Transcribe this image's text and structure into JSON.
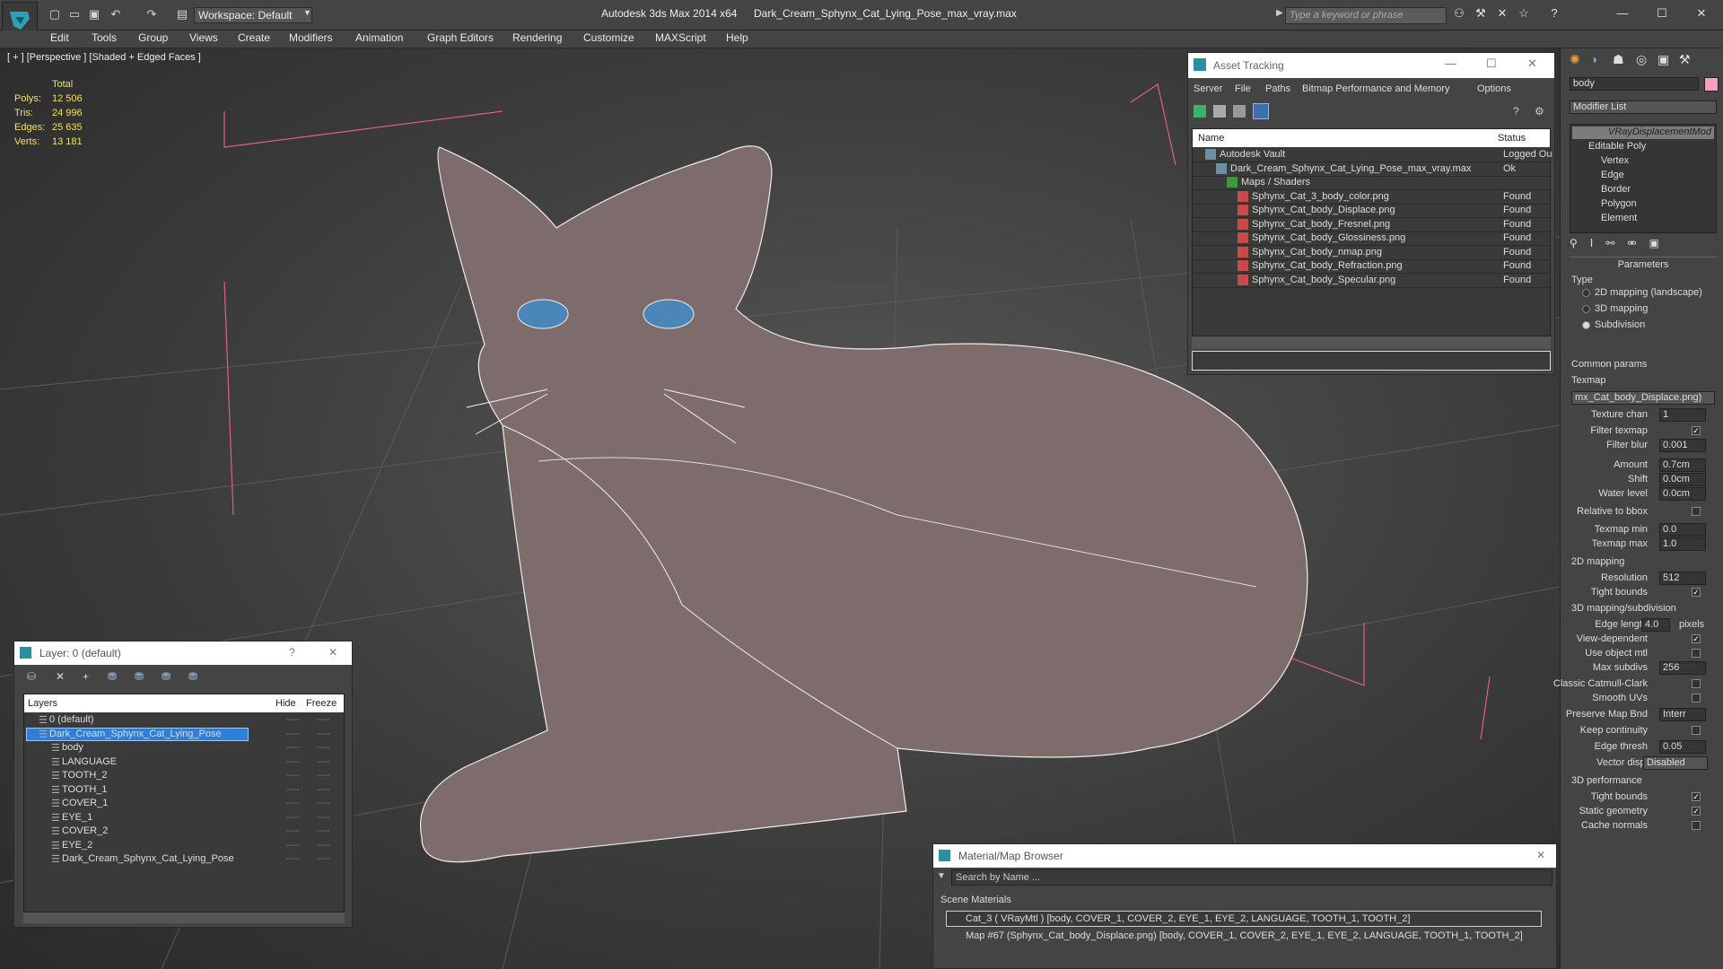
{
  "window": {
    "title": "Autodesk 3ds Max  2014 x64",
    "filename": "Dark_Cream_Sphynx_Cat_Lying_Pose_max_vray.max",
    "workspace": "Workspace: Default",
    "search_placeholder": "Type a keyword or phrase"
  },
  "menu": [
    "Edit",
    "Tools",
    "Group",
    "Views",
    "Create",
    "Modifiers",
    "Animation",
    "Graph Editors",
    "Rendering",
    "Customize",
    "MAXScript",
    "Help"
  ],
  "viewport": {
    "label": "[ + ] [Perspective ] [Shaded + Edged Faces ]",
    "stats": {
      "header": "Total",
      "rows": [
        {
          "k": "Polys:",
          "v": "12 506"
        },
        {
          "k": "Tris:",
          "v": "24 996"
        },
        {
          "k": "Edges:",
          "v": "25 635"
        },
        {
          "k": "Verts:",
          "v": "13 181"
        }
      ]
    }
  },
  "asset_tracking": {
    "title": "Asset Tracking",
    "menu": [
      "Server",
      "File",
      "Paths",
      "Bitmap Performance and Memory",
      "Options"
    ],
    "columns": [
      "Name",
      "Status"
    ],
    "rows": [
      {
        "name": "Autodesk Vault",
        "status": "Logged Ou"
      },
      {
        "name": "Dark_Cream_Sphynx_Cat_Lying_Pose_max_vray.max",
        "status": "Ok"
      },
      {
        "name": "Maps / Shaders",
        "status": ""
      },
      {
        "name": "Sphynx_Cat_3_body_color.png",
        "status": "Found"
      },
      {
        "name": "Sphynx_Cat_body_Displace.png",
        "status": "Found"
      },
      {
        "name": "Sphynx_Cat_body_Fresnel.png",
        "status": "Found"
      },
      {
        "name": "Sphynx_Cat_body_Glossiness.png",
        "status": "Found"
      },
      {
        "name": "Sphynx_Cat_body_nmap.png",
        "status": "Found"
      },
      {
        "name": "Sphynx_Cat_body_Refraction.png",
        "status": "Found"
      },
      {
        "name": "Sphynx_Cat_body_Specular.png",
        "status": "Found"
      }
    ]
  },
  "layer": {
    "title": "Layer: 0 (default)",
    "columns": [
      "Layers",
      "Hide",
      "Freeze"
    ],
    "rows": [
      "0 (default)",
      "Dark_Cream_Sphynx_Cat_Lying_Pose",
      "body",
      "LANGUAGE",
      "TOOTH_2",
      "TOOTH_1",
      "COVER_1",
      "EYE_1",
      "COVER_2",
      "EYE_2",
      "Dark_Cream_Sphynx_Cat_Lying_Pose"
    ]
  },
  "material_browser": {
    "title": "Material/Map Browser",
    "search_placeholder": "Search by Name ...",
    "section": "Scene Materials",
    "items": [
      "Cat_3  ( VRayMtl ) [body, COVER_1, COVER_2, EYE_1, EYE_2, LANGUAGE, TOOTH_1, TOOTH_2]",
      "Map #67 (Sphynx_Cat_body_Displace.png) [body, COVER_1, COVER_2, EYE_1, EYE_2, LANGUAGE, TOOTH_1, TOOTH_2]"
    ]
  },
  "command_panel": {
    "object_name": "body",
    "modifier_list": "Modifier List",
    "stack": [
      "VRayDisplacementMod",
      "Editable Poly",
      "Vertex",
      "Edge",
      "Border",
      "Polygon",
      "Element"
    ],
    "params": {
      "title": "Parameters",
      "type_label": "Type",
      "type_options": [
        "2D mapping (landscape)",
        "3D mapping",
        "Subdivision"
      ],
      "common_label": "Common params",
      "texmap_label": "Texmap",
      "texmap_value": "mx_Cat_body_Displace.png)",
      "texture_chan": "Texture chan",
      "texture_chan_val": "1",
      "filter_texmap": "Filter texmap",
      "filter_blur": "Filter blur",
      "filter_blur_val": "0.001",
      "amount": "Amount",
      "amount_val": "0.7cm",
      "shift": "Shift",
      "shift_val": "0.0cm",
      "water_level": "Water level",
      "water_level_val": "0.0cm",
      "relative_bbox": "Relative to bbox",
      "texmap_min": "Texmap min",
      "texmap_min_val": "0.0",
      "texmap_max": "Texmap max",
      "texmap_max_val": "1.0",
      "mapping2d": "2D mapping",
      "resolution": "Resolution",
      "resolution_val": "512",
      "tight_bounds": "Tight bounds",
      "mapping3d": "3D mapping/subdivision",
      "edge_length": "Edge length",
      "edge_length_val": "4.0",
      "pixels": "pixels",
      "view_dependent": "View-dependent",
      "use_object_mtl": "Use object mtl",
      "max_subdivs": "Max subdivs",
      "max_subdivs_val": "256",
      "classic_catmull": "Classic Catmull-Clark",
      "smooth_uvs": "Smooth UVs",
      "preserve_map": "Preserve Map Bnd",
      "preserve_map_val": "Interr",
      "keep_continuity": "Keep continuity",
      "edge_thresh": "Edge thresh",
      "edge_thresh_val": "0.05",
      "vector_displ": "Vector displ",
      "vector_displ_val": "Disabled",
      "perf": "3D performance",
      "tight_bounds2": "Tight bounds",
      "static_geometry": "Static geometry",
      "cache_normals": "Cache normals"
    }
  }
}
